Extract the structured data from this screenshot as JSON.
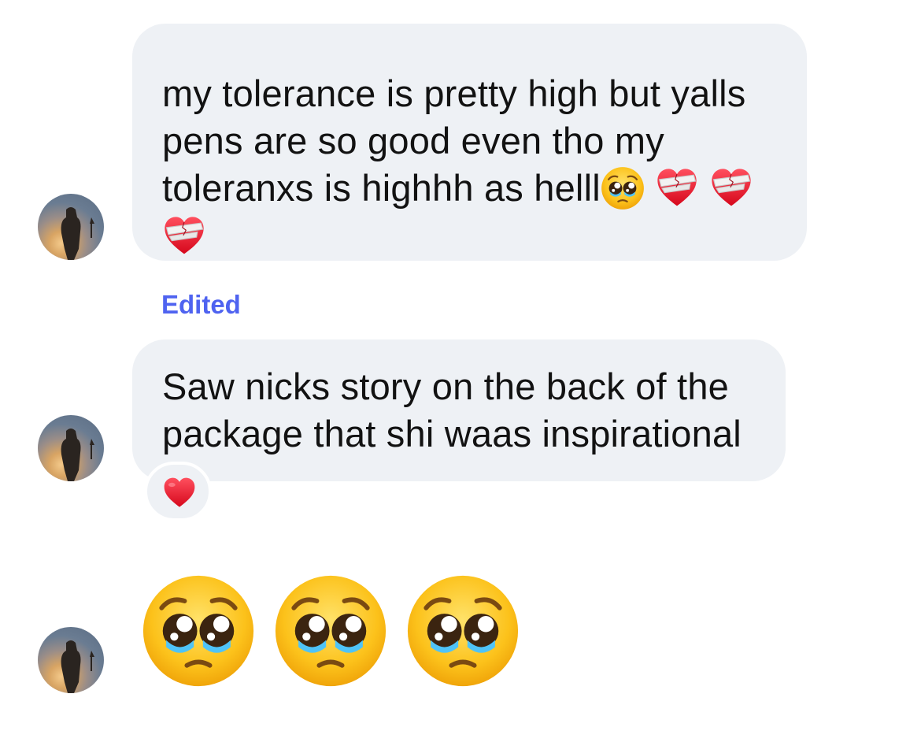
{
  "messages": [
    {
      "lines": [
        "my tolerance is pretty high but yalls",
        "pens are so good even tho my",
        "toleranxs is highhh as helll"
      ],
      "emoji": [
        "pleading-face",
        "mending-heart",
        "mending-heart",
        "mending-heart"
      ]
    },
    {
      "status": "Edited",
      "lines": [
        "Saw nicks story on the back of the",
        "package that shi waas inspirational"
      ],
      "reaction": "red-heart"
    },
    {
      "emoji": [
        "pleading-face",
        "pleading-face",
        "pleading-face"
      ]
    }
  ],
  "colors": {
    "bubble": "#eef1f5",
    "text": "#121212",
    "edited": "#4f63f0",
    "heart_red": "#e8192c"
  }
}
